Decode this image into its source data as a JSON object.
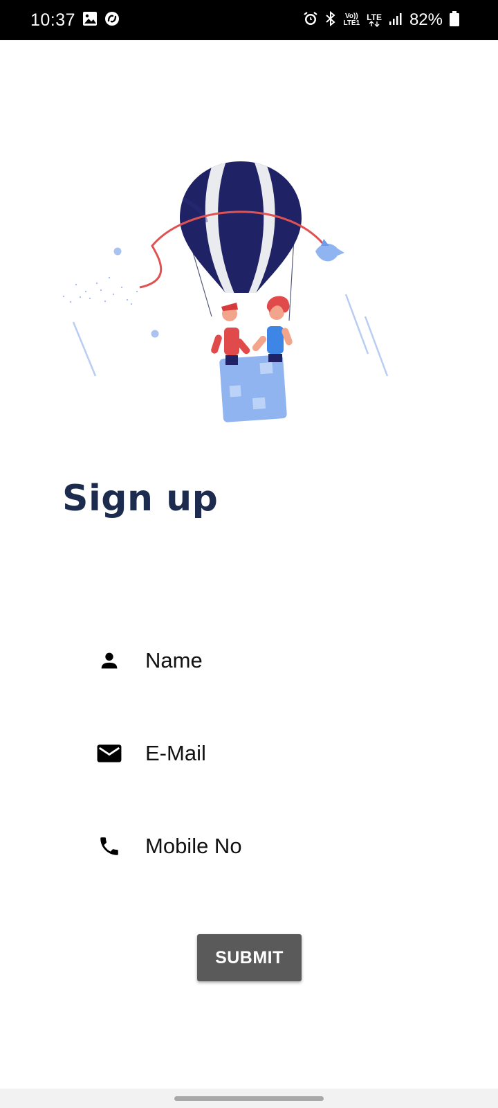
{
  "status_bar": {
    "time": "10:37",
    "lte_top": "LTE",
    "volte_top": "Vo))",
    "volte_bottom": "LTE1",
    "battery_text": "82%",
    "icons": [
      "gallery-icon",
      "sync-icon",
      "alarm-icon",
      "bluetooth-icon",
      "volte-icon",
      "lte-icon",
      "signal-icon",
      "battery-icon"
    ]
  },
  "hero": {
    "icon": "hot-air-balloon-illustration"
  },
  "page": {
    "title": "Sign up"
  },
  "form": {
    "name_placeholder": "Name",
    "email_placeholder": "E-Mail",
    "mobile_placeholder": "Mobile No",
    "submit_label": "SUBMIT",
    "icons": [
      "person-icon",
      "mail-icon",
      "phone-icon"
    ]
  },
  "colors": {
    "title": "#1d2b4f",
    "button": "#5a5a5a",
    "balloon_dark": "#1f2366",
    "balloon_light": "#e9ebee",
    "accent_red": "#e05252",
    "accent_blue": "#8fb4f0"
  }
}
